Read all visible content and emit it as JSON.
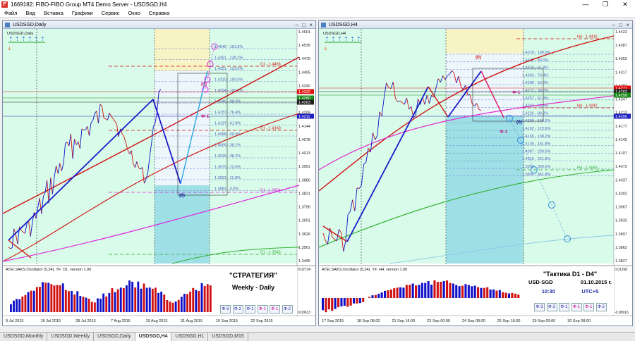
{
  "app": {
    "title": "1669182: FIBO-FIBO Group MT4 Demo Server - USDSGD,H4",
    "icon": "mt4-app-icon",
    "window_controls": [
      "—",
      "❐",
      "✕"
    ]
  },
  "menu": [
    "Файл",
    "Вид",
    "Вставка",
    "Графики",
    "Сервис",
    "Окно",
    "Справка"
  ],
  "left_chart": {
    "window_title": "USDSGD,Daily",
    "symbol_label": "USDSGD,Daily",
    "price_scale": [
      "1.4601",
      "1.4536",
      "1.4470",
      "1.4405",
      "1.4340",
      "1.4274",
      "1.4209",
      "1.4144",
      "1.4078",
      "1.4013",
      "1.3951",
      "1.3886",
      "1.3821",
      "1.3756",
      "1.3691",
      "1.3626",
      "1.3561",
      "1.3496"
    ],
    "price_tags": [
      {
        "text": "1.4332",
        "color": "#e01010"
      },
      {
        "text": "1.4280",
        "color": "#1a8a1a"
      },
      {
        "text": "1.4263",
        "color": "#202020"
      },
      {
        "text": "1.4211",
        "color": "#2020c0"
      }
    ],
    "fib_labels": [
      "1.4549 - 161.8%",
      "1.4451 - 138.2%",
      "1.4351 - 123.6%",
      "1.4310 - 100.0%",
      "1.4294 - 100.0%",
      "1.4245 - 88.2%",
      "1.4157 - 76.4%",
      "1.4137 - 61.8%",
      "1.4088 - 50.0%",
      "1.4069 - 38.2%",
      "1.4039 - 38.2%",
      "1.3979 - 23.6%",
      "1.3931 - 11.8%",
      "1.3882 - 0.0%"
    ],
    "line_labels": [
      "D1 - 1.4466",
      "D1 - 1.4160",
      "D1 - 1.3854",
      "D1 - 1.3548"
    ],
    "marks": [
      "(0)",
      "(0)",
      "Ф-1"
    ],
    "oscillator_title": "ATEI.SAKS.Oscillator (5,34). TF: D1. version 1.00",
    "oscillator_scale": [
      "0.02734",
      "0.00613"
    ],
    "dates": [
      "8 Jul 2015",
      "16 Jul 2015",
      "28 Jul 2015",
      "7 Aug 2015",
      "19 Aug 2015",
      "31 Aug 2015",
      "10 Sep 2015",
      "22 Sep 2015"
    ],
    "strategy_title": "\"СТРАТЕГИЯ\"",
    "strategy_sub": "Weekly - Daily",
    "nav_buttons": [
      "Ф-3",
      "Ф-2",
      "Ф-1",
      "Ф-1",
      "Ф-1",
      "Ф-2"
    ]
  },
  "right_chart": {
    "window_title": "USDSGD,H4",
    "symbol_label": "USDSGD,H4",
    "price_scale": [
      "1.4422",
      "1.4387",
      "1.4352",
      "1.4317",
      "1.4282",
      "1.4247",
      "1.4212",
      "1.4177",
      "1.4142",
      "1.4107",
      "1.4072",
      "1.4037",
      "1.4002",
      "1.3967",
      "1.3932",
      "1.3897",
      "1.3862",
      "1.3827"
    ],
    "price_tags": [
      {
        "text": "1.4271",
        "color": "#e01010"
      },
      {
        "text": "1.4263",
        "color": "#202020"
      },
      {
        "text": "1.4258",
        "color": "#1a8a1a"
      },
      {
        "text": "1.4200",
        "color": "#2020c0"
      }
    ],
    "fib_labels": [
      "1.4376 - 190.0%",
      "1.4332 - 80.0%",
      "1.4316 - 61.8%",
      "1.4303 - 76.4%",
      "1.4286 - 50.0%",
      "1.4272 - 38.2%",
      "1.4257 - 61.8%",
      "1.4240 - 23.6%",
      "1.4226 - 88.2%",
      "1.4200 - 100.0%",
      "1.4182 - 123.6%",
      "1.4165 - 138.2%",
      "1.4136 - 161.8%",
      "1.4087 - 200.0%",
      "1.4015 - 261.8%",
      "1.3959 - 300.0%",
      "1.3894 - 361.8%"
    ],
    "line_labels": [
      "H4 - 1.4416",
      "H4 - 1.4242",
      "H4 - 1.4069"
    ],
    "marks": [
      "(0)",
      "(0)",
      "Ф-1",
      "Ф-1"
    ],
    "oscillator_title": "ATEI.SAKS.Oscillator (5,34). TF: H4. version 1.00",
    "oscillator_scale": [
      "0.01268",
      "-0.00916"
    ],
    "dates": [
      "17 Sep 2015",
      "18 Sep 08:00",
      "21 Sep 16:00",
      "23 Sep 00:00",
      "24 Sep 08:00",
      "25 Sep 16:00",
      "29 Sep 00:00",
      "30 Sep 08:00"
    ],
    "tactic_title": "\"Тактика  D1 - D4\"",
    "tactic_pair": "USD-SGD",
    "tactic_date": "01.10.2015 г.",
    "tactic_time": "10:30",
    "tactic_tz": "UTC+5",
    "nav_buttons": [
      "Ф-3",
      "Ф-2",
      "Ф-1",
      "Ф-1",
      "Ф-1",
      "Ф-2"
    ]
  },
  "tabs": [
    "USDSGD,Monthly",
    "USDSGD,Weekly",
    "USDSGD,Daily",
    "USDSGD,H4",
    "USDSGD,H1",
    "USDSGD,M15"
  ],
  "active_tab": "USDSGD,H4",
  "colors": {
    "chart_bg": "#d9fbe9",
    "zone_yellow": "#f7f3c4",
    "zone_cyan": "#9fe0e6",
    "bull_bar": "#1010c8",
    "bear_bar": "#d01010",
    "ma_red": "#d01010",
    "ma_magenta": "#e020e0",
    "ma_green": "#30b030",
    "fib_blue": "#6a7ad0"
  }
}
